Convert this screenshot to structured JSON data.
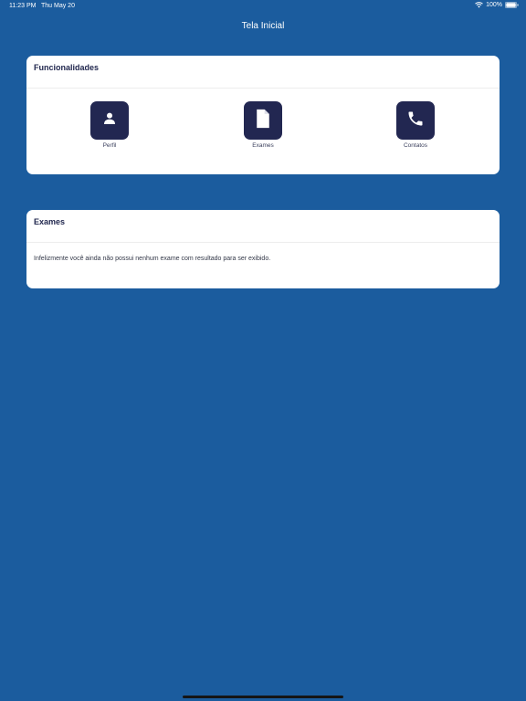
{
  "status_bar": {
    "time": "11:23 PM",
    "date": "Thu May 20",
    "battery": "100%"
  },
  "nav": {
    "title": "Tela Inicial"
  },
  "features_card": {
    "title": "Funcionalidades",
    "items": [
      {
        "label": "Perfil",
        "icon": "person-icon"
      },
      {
        "label": "Exames",
        "icon": "document-icon"
      },
      {
        "label": "Contatos",
        "icon": "phone-icon"
      }
    ]
  },
  "exams_card": {
    "title": "Exames",
    "message": "Infelizmente você ainda não possui nenhum exame com resultado para ser exibido."
  },
  "colors": {
    "background": "#1b5c9e",
    "tile": "#222751",
    "card": "#ffffff"
  }
}
